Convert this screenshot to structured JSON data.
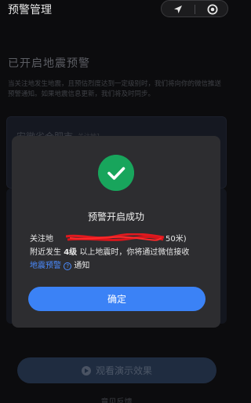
{
  "header": {
    "title": "预警管理"
  },
  "background": {
    "section_title": "已开启地震预警",
    "description": "当关注地发生地震，且预估烈度达到一定级别时，我们将向你的微信推送预警通知。如果地震信息更新，我们将及时同步。",
    "card_location": "安徽省合肥市",
    "card_tag": "关注地1",
    "demo_button": "观看演示效果",
    "feedback_link": "意见反馈"
  },
  "modal": {
    "title": "预警开启成功",
    "line1_prefix": "关注地",
    "line1_suffix": "50米)",
    "line2_a": "附近发生",
    "line2_level": "4级",
    "line2_b": "以上地震时，你将通过微信接收",
    "link": "地震预警",
    "help_glyph": "?",
    "notice": "通知",
    "confirm": "确定"
  },
  "colors": {
    "accent": "#3b82f6",
    "success": "#18a55c",
    "link": "#4b8cff"
  }
}
